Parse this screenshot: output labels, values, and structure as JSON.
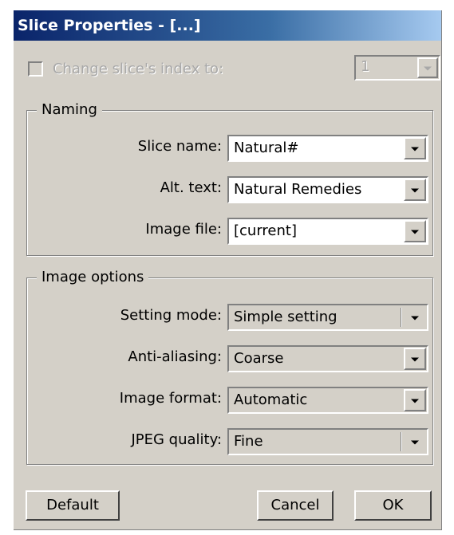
{
  "window": {
    "title": "Slice Properties - [...]"
  },
  "change_index": {
    "label": "Change slice's index to:",
    "value": "1"
  },
  "naming": {
    "title": "Naming",
    "slice_name": {
      "label": "Slice name:",
      "value": "Natural#"
    },
    "alt_text": {
      "label": "Alt. text:",
      "value": "Natural Remedies"
    },
    "image_file": {
      "label": "Image file:",
      "value": "[current]"
    }
  },
  "image_options": {
    "title": "Image options",
    "setting_mode": {
      "label": "Setting mode:",
      "value": "Simple setting"
    },
    "anti_aliasing": {
      "label": "Anti-aliasing:",
      "value": "Coarse"
    },
    "image_format": {
      "label": "Image format:",
      "value": "Automatic"
    },
    "jpeg_quality": {
      "label": "JPEG quality:",
      "value": "Fine"
    }
  },
  "buttons": {
    "default": "Default",
    "cancel": "Cancel",
    "ok": "OK"
  },
  "colors": {
    "face": "#d4d0c8",
    "title_start": "#0a246a",
    "title_end": "#a6caf0",
    "disabled_text": "#a8a8a8"
  }
}
